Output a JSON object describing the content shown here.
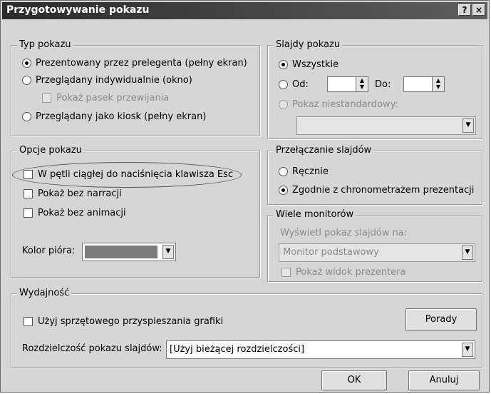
{
  "window": {
    "title": "Przygotowywanie pokazu",
    "help_btn": "?",
    "close_btn": "×"
  },
  "typ_pokazu": {
    "legend": "Typ pokazu",
    "opt1": "Prezentowany przez prelegenta (pełny ekran)",
    "opt2": "Przeglądany indywidualnie (okno)",
    "opt2_sub": "Pokaż pasek przewijania",
    "opt3": "Przeglądany jako kiosk (pełny ekran)"
  },
  "slajdy": {
    "legend": "Slajdy pokazu",
    "all": "Wszystkie",
    "od": "Od:",
    "do": "Do:",
    "custom": "Pokaz niestandardowy:"
  },
  "opcje": {
    "legend": "Opcje pokazu",
    "loop": "W pętli ciągłej do naciśnięcia klawisza Esc",
    "no_narr": "Pokaż bez narracji",
    "no_anim": "Pokaż bez animacji",
    "pen": "Kolor pióra:",
    "pen_color": "#7d7d7d"
  },
  "przelaczanie": {
    "legend": "Przełączanie slajdów",
    "manual": "Ręcznie",
    "timings": "Zgodnie z chronometrażem prezentacji"
  },
  "monitory": {
    "legend": "Wiele monitorów",
    "label": "Wyświetl pokaz slajdów na:",
    "value": "Monitor podstawowy",
    "presenter": "Pokaż widok prezentera"
  },
  "wydajnosc": {
    "legend": "Wydajność",
    "hw": "Użyj sprzętowego przyspieszania grafiki",
    "tips": "Porady",
    "res_label": "Rozdzielczość pokazu slajdów:",
    "res_value": "[Użyj bieżącej rozdzielczości]"
  },
  "buttons": {
    "ok": "OK",
    "cancel": "Anuluj"
  }
}
